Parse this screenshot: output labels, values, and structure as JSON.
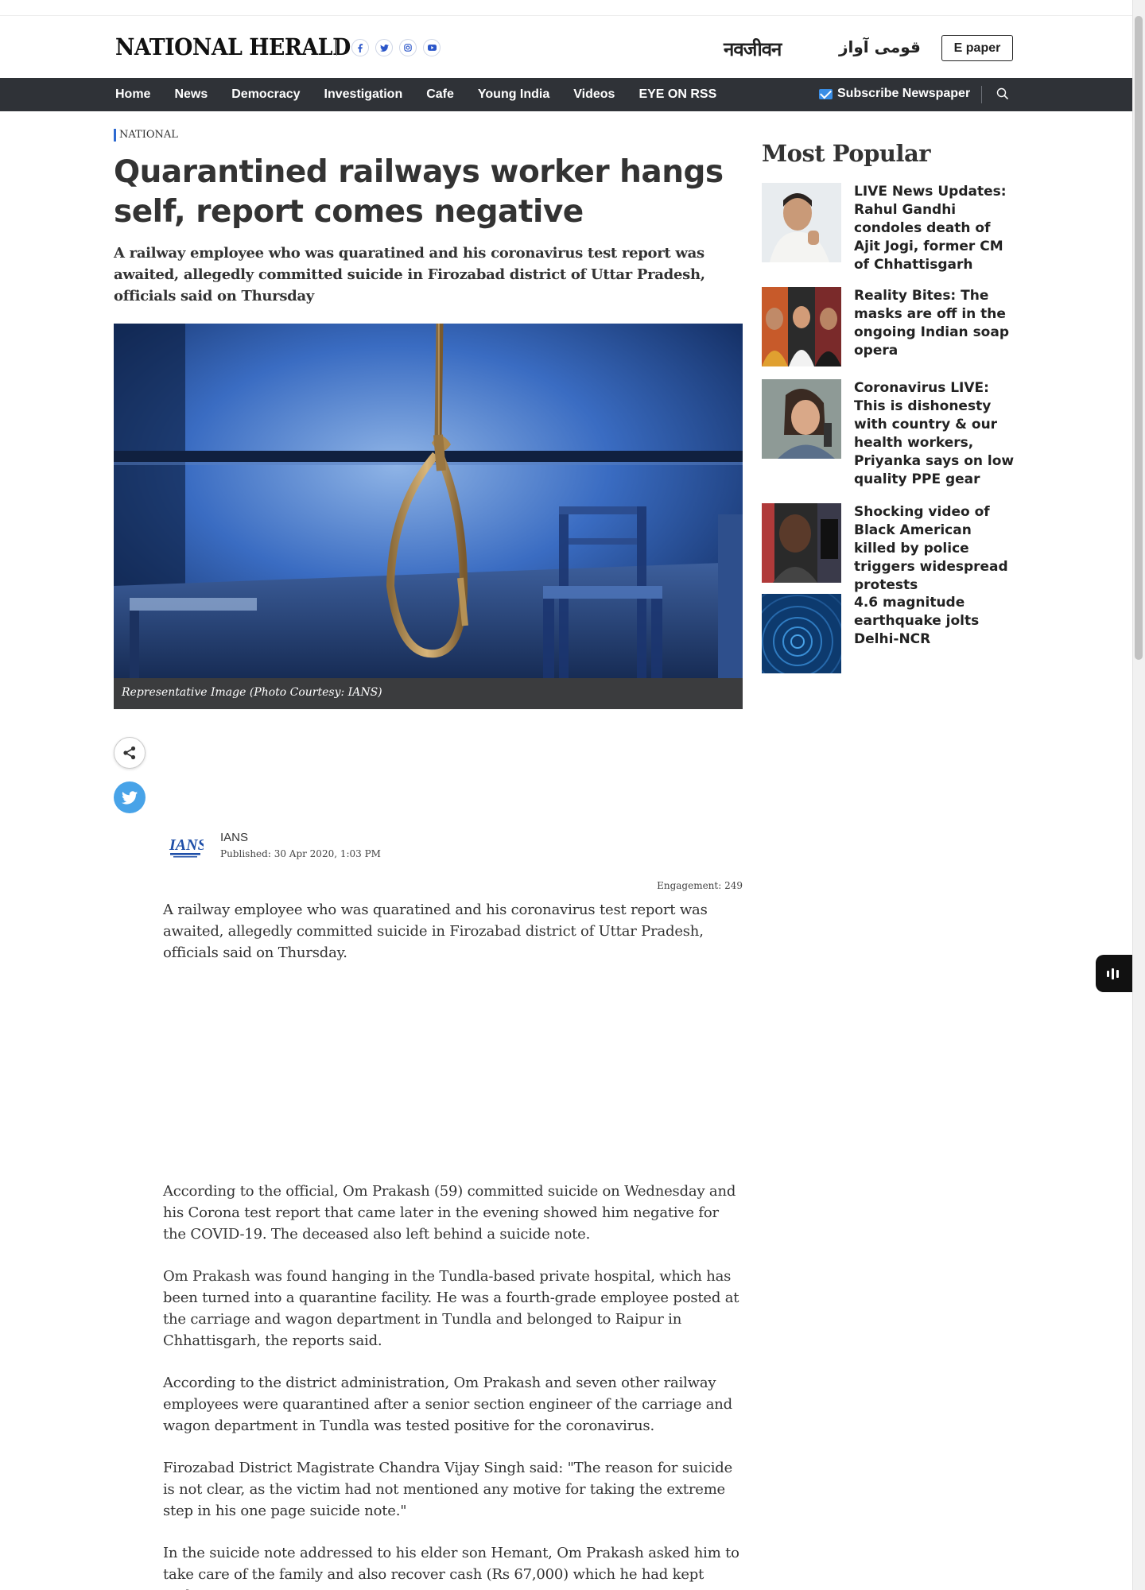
{
  "header": {
    "logo": "NATIONAL HERALD",
    "socials": [
      "f",
      "t",
      "in",
      "yt"
    ],
    "sister_site_1": "नवजीवन",
    "sister_site_2": "قومی آواز",
    "epaper_label": "E paper"
  },
  "nav": {
    "items": [
      "Home",
      "News",
      "Democracy",
      "Investigation",
      "Cafe",
      "Young India",
      "Videos",
      "EYE ON RSS"
    ],
    "subscribe_label": "Subscribe Newspaper"
  },
  "article": {
    "category": "NATIONAL",
    "headline": "Quarantined railways worker hangs self, report comes negative",
    "subhead": "A railway employee who was quaratined and his coronavirus test report was awaited, allegedly committed suicide in Firozabad district of Uttar Pradesh, officials said on Thursday",
    "image_caption": "Representative Image (Photo Courtesy: IANS)",
    "author": "IANS",
    "author_logo_text": "IANS",
    "published": "Published: 30 Apr 2020, 1:03 PM",
    "engagement": "Engagement: 249",
    "paragraphs": [
      "A railway employee who was quaratined and his coronavirus test report was awaited, allegedly committed suicide in Firozabad district of Uttar Pradesh, officials said on Thursday.",
      "According to the official, Om Prakash (59) committed suicide on Wednesday and his Corona test report that came later in the evening showed him negative for the COVID-19. The deceased also left behind a suicide note.",
      "Om Prakash was found hanging in the Tundla-based private hospital, which has been turned into a quarantine facility. He was a fourth-grade employee posted at the carriage and wagon department in Tundla and belonged to Raipur in Chhattisgarh, the reports said.",
      "According to the district administration, Om Prakash and seven other railway employees were quarantined after a senior section engineer of the carriage and wagon department in Tundla was tested positive for the coronavirus.",
      "Firozabad District Magistrate Chandra Vijay Singh said: \"The reason for suicide is not clear, as the victim had not mentioned any motive for taking the extreme step in his one page suicide note.\"",
      "In the suicide note addressed to his elder son Hemant, Om Prakash asked him to take care of the family and also recover cash (Rs 67,000) which he had kept under"
    ]
  },
  "sidebar": {
    "title": "Most Popular",
    "items": [
      {
        "title": "LIVE News Updates: Rahul Gandhi condoles death of Ajit Jogi, former CM of Chhattisgarh"
      },
      {
        "title": "Reality Bites: The masks are off in the ongoing Indian soap opera"
      },
      {
        "title": "Coronavirus LIVE: This is dishonesty with country & our health workers, Priyanka says on low quality PPE gear"
      },
      {
        "title": "Shocking video of Black American killed by police triggers widespread protests"
      },
      {
        "title": "4.6 magnitude earthquake jolts Delhi-NCR"
      }
    ]
  },
  "colors": {
    "nav_bg": "#2f3237",
    "accent_blue": "#2e6ad1",
    "twitter": "#48a3e8",
    "caption_bg": "#3b3c3e"
  }
}
